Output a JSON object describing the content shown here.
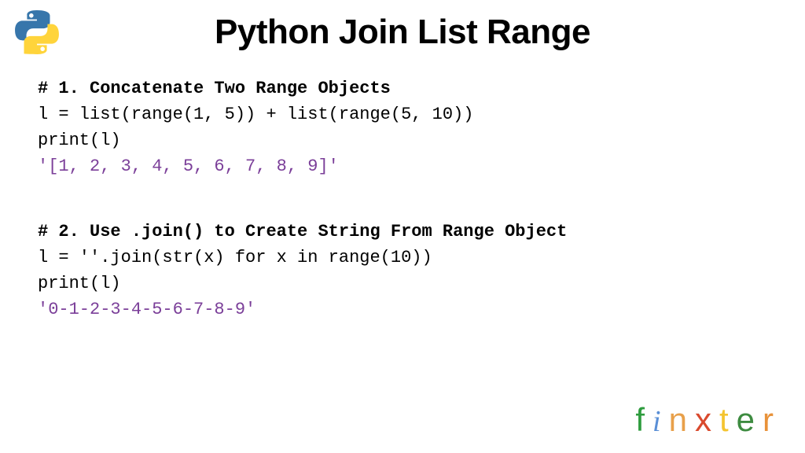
{
  "title": "Python Join List Range",
  "logo_name": "python-logo",
  "blocks": [
    {
      "comment": "# 1. Concatenate Two Range Objects",
      "lines": [
        "l = list(range(1, 5)) + list(range(5, 10))",
        "print(l)"
      ],
      "output": "'[1, 2, 3, 4, 5, 6, 7, 8, 9]'"
    },
    {
      "comment": "# 2. Use .join() to Create String From Range Object",
      "lines": [
        "l = ''.join(str(x) for x in range(10))",
        "print(l)"
      ],
      "output": "'0-1-2-3-4-5-6-7-8-9'"
    }
  ],
  "brand": {
    "letters": [
      "f",
      "i",
      "n",
      "x",
      "t",
      "e",
      "r"
    ]
  }
}
